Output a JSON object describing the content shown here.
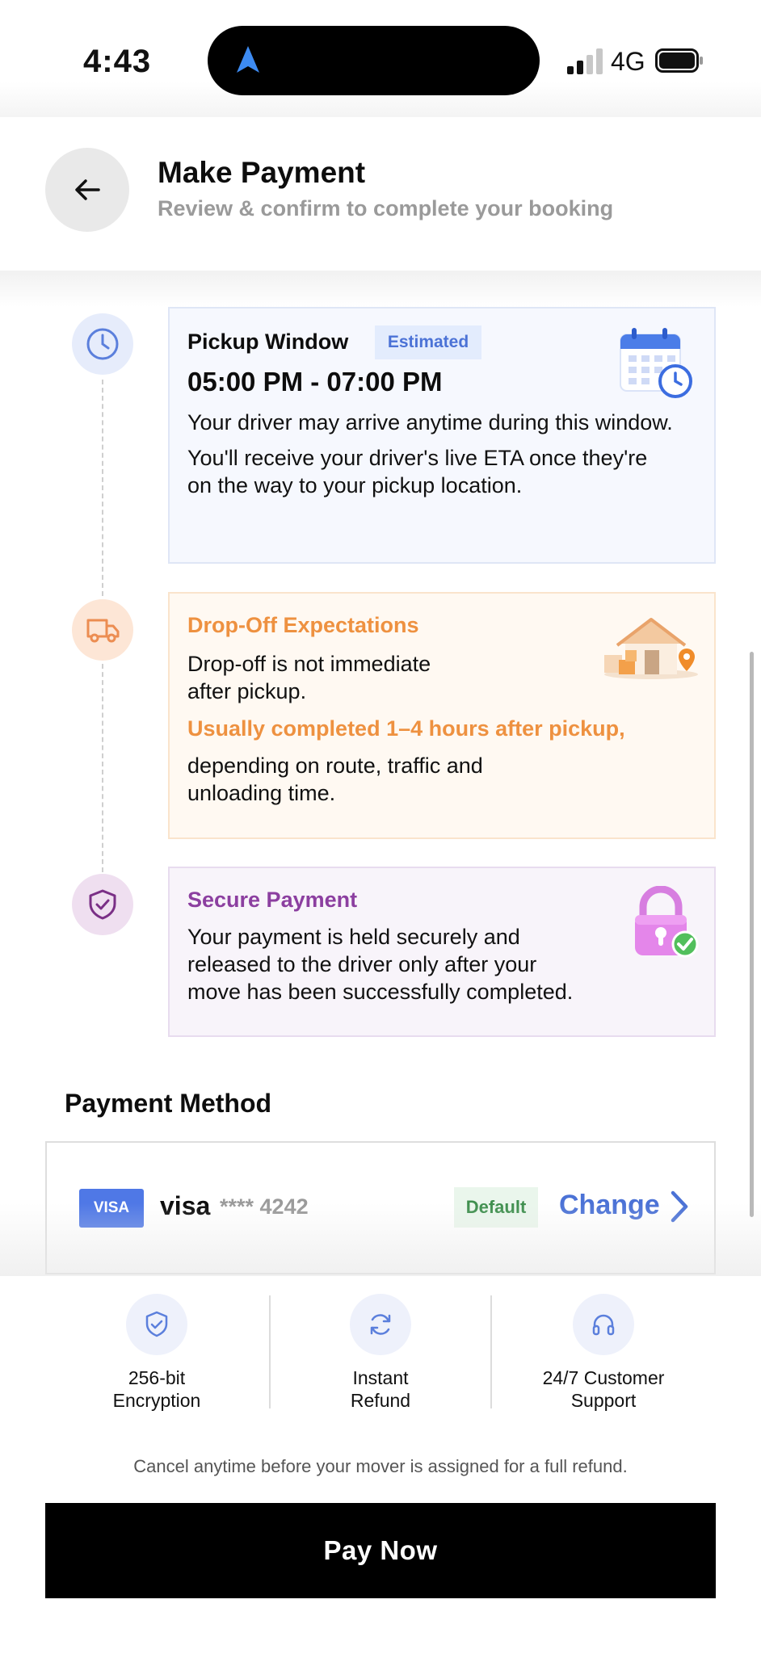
{
  "status_bar": {
    "time": "4:43",
    "network": "4G",
    "icons": [
      "location-arrow-icon",
      "signal-bars-icon",
      "battery-icon"
    ]
  },
  "header": {
    "title": "Make Payment",
    "subtitle": "Review & confirm to complete your booking",
    "back_icon": "arrow-left-icon"
  },
  "timeline": {
    "pickup": {
      "icon": "clock-icon",
      "title": "Pickup Window",
      "badge": "Estimated",
      "time_window": "05:00 PM - 07:00 PM",
      "text1": "Your driver may arrive anytime during this window.",
      "text2_line1": "You'll receive your driver's live ETA once they're",
      "text2_line2": "on the way to your pickup location.",
      "illustration": "calendar-clock-icon",
      "accent": "#4b72d6"
    },
    "dropoff": {
      "icon": "truck-icon",
      "title": "Drop-Off Expectations",
      "text1_line1": "Drop-off is not immediate",
      "text1_line2": "after pickup.",
      "highlight": "Usually completed 1–4 hours after pickup,",
      "text2_line1": "depending on route, traffic and",
      "text2_line2": "unloading time.",
      "illustration": "house-boxes-icon",
      "accent": "#f0913a"
    },
    "secure": {
      "icon": "shield-check-icon",
      "title": "Secure Payment",
      "text_line1": "Your payment is held securely and",
      "text_line2": "released to the driver only after your",
      "text_line3": "move has been successfully completed.",
      "illustration": "padlock-check-icon",
      "accent": "#8c3fa0"
    }
  },
  "payment_method": {
    "heading": "Payment Method",
    "card_badge": "VISA",
    "brand": "visa",
    "masked_number": "**** 4242",
    "default_label": "Default",
    "change_label": "Change"
  },
  "features": [
    {
      "icon": "shield-check-icon",
      "label": "256-bit\nEncryption"
    },
    {
      "icon": "refresh-icon",
      "label": "Instant\nRefund"
    },
    {
      "icon": "headphones-icon",
      "label": "24/7 Customer\nSupport"
    }
  ],
  "refund_note": "Cancel anytime before your mover is assigned for a full refund.",
  "pay_button": "Pay Now"
}
